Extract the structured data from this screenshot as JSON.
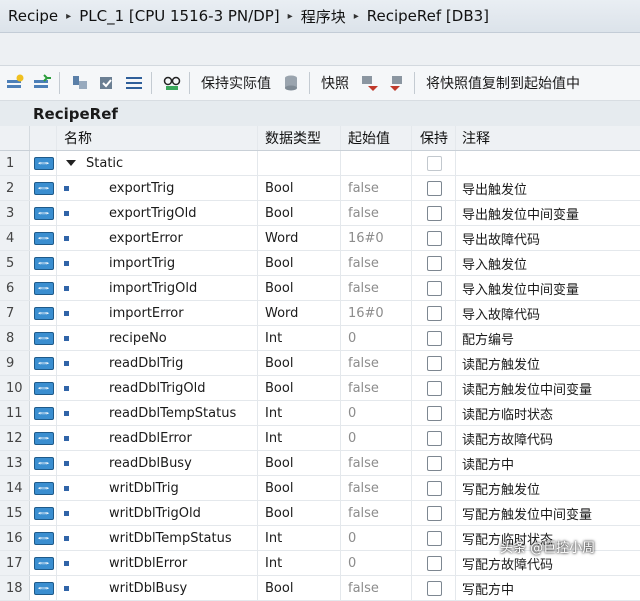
{
  "breadcrumb": {
    "items": [
      "Recipe",
      "PLC_1 [CPU 1516-3 PN/DP]",
      "程序块",
      "RecipeRef [DB3]"
    ],
    "separator": "▸"
  },
  "toolbar": {
    "keep_actual_label": "保持实际值",
    "snapshot_label": "快照",
    "copy_snapshot_label": "将快照值复制到起始值中"
  },
  "block": {
    "name": "RecipeRef"
  },
  "table": {
    "headers": {
      "name": "名称",
      "type": "数据类型",
      "start": "起始值",
      "retain": "保持",
      "comment": "注释"
    },
    "rows": [
      {
        "num": "1",
        "name": "Static",
        "type": "",
        "start": "",
        "comment": "",
        "kind": "section"
      },
      {
        "num": "2",
        "name": "exportTrig",
        "type": "Bool",
        "start": "false",
        "comment": "导出触发位"
      },
      {
        "num": "3",
        "name": "exportTrigOld",
        "type": "Bool",
        "start": "false",
        "comment": "导出触发位中间变量"
      },
      {
        "num": "4",
        "name": "exportError",
        "type": "Word",
        "start": "16#0",
        "comment": "导出故障代码"
      },
      {
        "num": "5",
        "name": "importTrig",
        "type": "Bool",
        "start": "false",
        "comment": "导入触发位"
      },
      {
        "num": "6",
        "name": "importTrigOld",
        "type": "Bool",
        "start": "false",
        "comment": "导入触发位中间变量"
      },
      {
        "num": "7",
        "name": "importError",
        "type": "Word",
        "start": "16#0",
        "comment": "导入故障代码"
      },
      {
        "num": "8",
        "name": "recipeNo",
        "type": "Int",
        "start": "0",
        "comment": "配方编号"
      },
      {
        "num": "9",
        "name": "readDblTrig",
        "type": "Bool",
        "start": "false",
        "comment": "读配方触发位"
      },
      {
        "num": "10",
        "name": "readDblTrigOld",
        "type": "Bool",
        "start": "false",
        "comment": "读配方触发位中间变量"
      },
      {
        "num": "11",
        "name": "readDblTempStatus",
        "type": "Int",
        "start": "0",
        "comment": "读配方临时状态"
      },
      {
        "num": "12",
        "name": "readDblError",
        "type": "Int",
        "start": "0",
        "comment": "读配方故障代码"
      },
      {
        "num": "13",
        "name": "readDblBusy",
        "type": "Bool",
        "start": "false",
        "comment": "读配方中"
      },
      {
        "num": "14",
        "name": "writDblTrig",
        "type": "Bool",
        "start": "false",
        "comment": "写配方触发位"
      },
      {
        "num": "15",
        "name": "writDblTrigOld",
        "type": "Bool",
        "start": "false",
        "comment": "写配方触发位中间变量"
      },
      {
        "num": "16",
        "name": "writDblTempStatus",
        "type": "Int",
        "start": "0",
        "comment": "写配方临时状态"
      },
      {
        "num": "17",
        "name": "writDblError",
        "type": "Int",
        "start": "0",
        "comment": "写配方故障代码"
      },
      {
        "num": "18",
        "name": "writDblBusy",
        "type": "Bool",
        "start": "false",
        "comment": "写配方中"
      }
    ]
  },
  "icons": [
    "interface-icon",
    "expand-triangle-icon",
    "variable-bullet-icon"
  ],
  "watermark": "头条 @巨控小周",
  "colors": {
    "accent": "#3a8ed0",
    "header_bg": "#eef1f4",
    "start_value_text": "#8c8c8c"
  }
}
